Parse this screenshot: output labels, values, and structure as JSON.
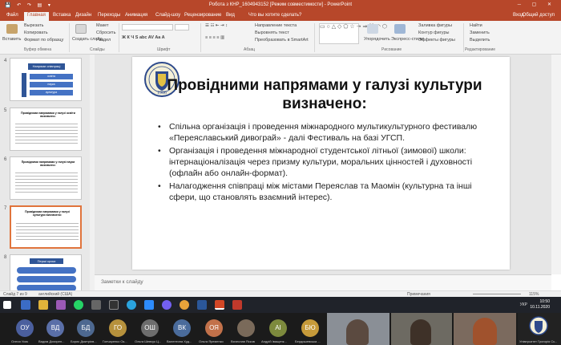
{
  "window": {
    "title": "Робота з КНР_1604943152 [Режим совместимости] - PowerPoint",
    "quick_access": "💾 ↶ ↷ ▤ ▾",
    "controls": "─ ▢ ✕"
  },
  "tabs": [
    "Файл",
    "Главная",
    "Вставка",
    "Дизайн",
    "Переходы",
    "Анимация",
    "Слайд-шоу",
    "Рецензирование",
    "Вид"
  ],
  "help_search": "Что вы хотите сделать?",
  "user": "Вход",
  "share": "Общий доступ",
  "ribbon": {
    "clipboard": {
      "paste": "Вставить",
      "cut": "Вырезать",
      "copy": "Копировать",
      "format": "Формат по образцу",
      "label": "Буфер обмена"
    },
    "slides": {
      "new": "Создать слайд",
      "layout": "Макет",
      "reset": "Сбросить",
      "section": "Раздел",
      "label": "Слайды"
    },
    "font": {
      "label": "Шрифт"
    },
    "paragraph": {
      "direction": "Направление текста",
      "align": "Выровнять текст",
      "smartart": "Преобразовать в SmartArt",
      "label": "Абзац"
    },
    "drawing": {
      "arrange": "Упорядочить",
      "styles": "Экспресс-стили",
      "fill": "Заливка фигуры",
      "outline": "Контур фигуры",
      "effects": "Эффекты фигуры",
      "label": "Рисование"
    },
    "editing": {
      "find": "Найти",
      "replace": "Заменить",
      "select": "Выделить",
      "label": "Редактирование"
    }
  },
  "thumbnails": [
    {
      "num": "4",
      "title": "Напрями співпраці",
      "items": [
        "освіта",
        "наука",
        "культура"
      ]
    },
    {
      "num": "5",
      "title": "Провідними напрямами у галузі освіти визначено:"
    },
    {
      "num": "6",
      "title": "Провідними напрямами у галузі науки визначено:"
    },
    {
      "num": "7",
      "title": "Провідними напрямами у галузі культури визначено:",
      "selected": true
    },
    {
      "num": "8",
      "title": "Перші кроки"
    }
  ],
  "slide": {
    "logo_year": "1986",
    "title": "Провідними напрямами у галузі культури визначено:",
    "bullets": [
      "Спільна організація і проведення міжнародного мультикультурного фестивалю «Переяславський дивограй» - далі Фестиваль на базі УГСП.",
      "Організація і проведення міжнародної студентської літньої (зимової) школи: інтернаціоналізація через призму культури, моральних цінностей і духовності (офлайн або онлайн-формат).",
      "Налагодження співпраці між містами Переяслав та Маомін (культурна та інші сфери, що становлять взаємний інтерес)."
    ]
  },
  "notes_placeholder": "Заметки к слайду",
  "status": {
    "slide": "Слайд 7 из 9",
    "lang": "английский (США)",
    "notes": "Примечания",
    "comments": "",
    "zoom": "115%"
  },
  "taskbar": {
    "time": "10:50",
    "date": "10.11.2020",
    "lang": "УКР"
  },
  "participants": [
    {
      "initials": "ОУ",
      "name": "Олеся Усик",
      "color": "#4b5f9e"
    },
    {
      "initials": "ВД",
      "name": "Вадим Дохирен...",
      "color": "#5a6fa8"
    },
    {
      "initials": "БД",
      "name": "Борис Дмитрієв...",
      "color": "#4d6890"
    },
    {
      "initials": "ГО",
      "name": "Гончаренко Ок...",
      "color": "#b6913c"
    },
    {
      "initials": "ОШ",
      "name": "Ольга Шевчук Ц...",
      "color": "#6d6d6d"
    },
    {
      "initials": "ВК",
      "name": "Валентина Худ...",
      "color": "#4a6b9b"
    },
    {
      "initials": "ОЯ",
      "name": "Ольга Яременко",
      "color": "#c2714a"
    },
    {
      "initials": "",
      "name": "Вячеслав Ясков",
      "color": "#7a6a5a"
    },
    {
      "initials": "АІ",
      "name": "Андрій Іващенк...",
      "color": "#7d8a3d"
    },
    {
      "initials": "БЮ",
      "name": "Бердишевська ...",
      "color": "#c69a3a"
    }
  ],
  "video_tiles": [
    "",
    "",
    ""
  ],
  "university_label": "Університет Григорія Ск..."
}
